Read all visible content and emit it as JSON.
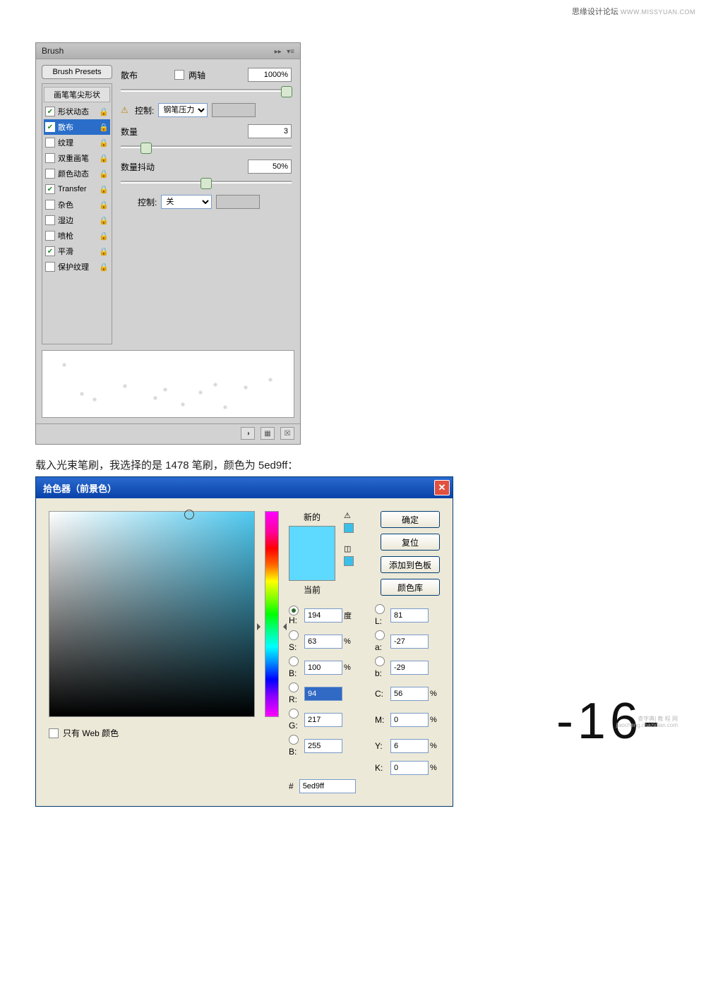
{
  "source_site": "思缘设计论坛",
  "source_url": "WWW.MISSYUAN.COM",
  "page_number": "-16-",
  "instruction_text": "载入光束笔刷，我选择的是 1478 笔刷，颜色为 5ed9ff：",
  "corner_mark_1": "查字典| 教 程 网",
  "corner_mark_2": "jiaocheng.chazidian.com",
  "brush_panel": {
    "title": "Brush",
    "presets_button": "Brush Presets",
    "list_header": "画笔笔尖形状",
    "items": [
      {
        "label": "形状动态",
        "checked": true,
        "locked": true
      },
      {
        "label": "散布",
        "checked": true,
        "locked": true,
        "selected": true
      },
      {
        "label": "纹理",
        "checked": false,
        "locked": true
      },
      {
        "label": "双重画笔",
        "checked": false,
        "locked": true
      },
      {
        "label": "颜色动态",
        "checked": false,
        "locked": true
      },
      {
        "label": "Transfer",
        "checked": true,
        "locked": true
      },
      {
        "label": "杂色",
        "checked": false,
        "locked": true
      },
      {
        "label": "湿边",
        "checked": false,
        "locked": true
      },
      {
        "label": "喷枪",
        "checked": false,
        "locked": true
      },
      {
        "label": "平滑",
        "checked": true,
        "locked": true
      },
      {
        "label": "保护纹理",
        "checked": false,
        "locked": true
      }
    ],
    "settings": {
      "scatter_label": "散布",
      "both_axes_label": "两轴",
      "scatter_value": "1000%",
      "control1_label": "控制:",
      "control1_value": "钢笔压力",
      "count_label": "数量",
      "count_value": "3",
      "jitter_label": "数量抖动",
      "jitter_value": "50%",
      "control2_label": "控制:",
      "control2_value": "关"
    }
  },
  "color_picker": {
    "title": "拾色器（前景色）",
    "new_label": "新的",
    "current_label": "当前",
    "buttons": {
      "ok": "确定",
      "reset": "复位",
      "add": "添加到色板",
      "library": "颜色库"
    },
    "web_only_label": "只有 Web 颜色",
    "values": {
      "H_label": "H:",
      "H": "194",
      "H_unit": "度",
      "S_label": "S:",
      "S": "63",
      "S_unit": "%",
      "Bv_label": "B:",
      "Bv": "100",
      "Bv_unit": "%",
      "R_label": "R:",
      "R": "94",
      "G_label": "G:",
      "G": "217",
      "B_label": "B:",
      "B": "255",
      "L_label": "L:",
      "L": "81",
      "a_label": "a:",
      "a": "-27",
      "b_label": "b:",
      "b": "-29",
      "C_label": "C:",
      "C": "56",
      "C_unit": "%",
      "M_label": "M:",
      "M": "0",
      "M_unit": "%",
      "Y_label": "Y:",
      "Y": "6",
      "Y_unit": "%",
      "K_label": "K:",
      "K": "0",
      "K_unit": "%",
      "hex_label": "#",
      "hex": "5ed9ff"
    }
  }
}
